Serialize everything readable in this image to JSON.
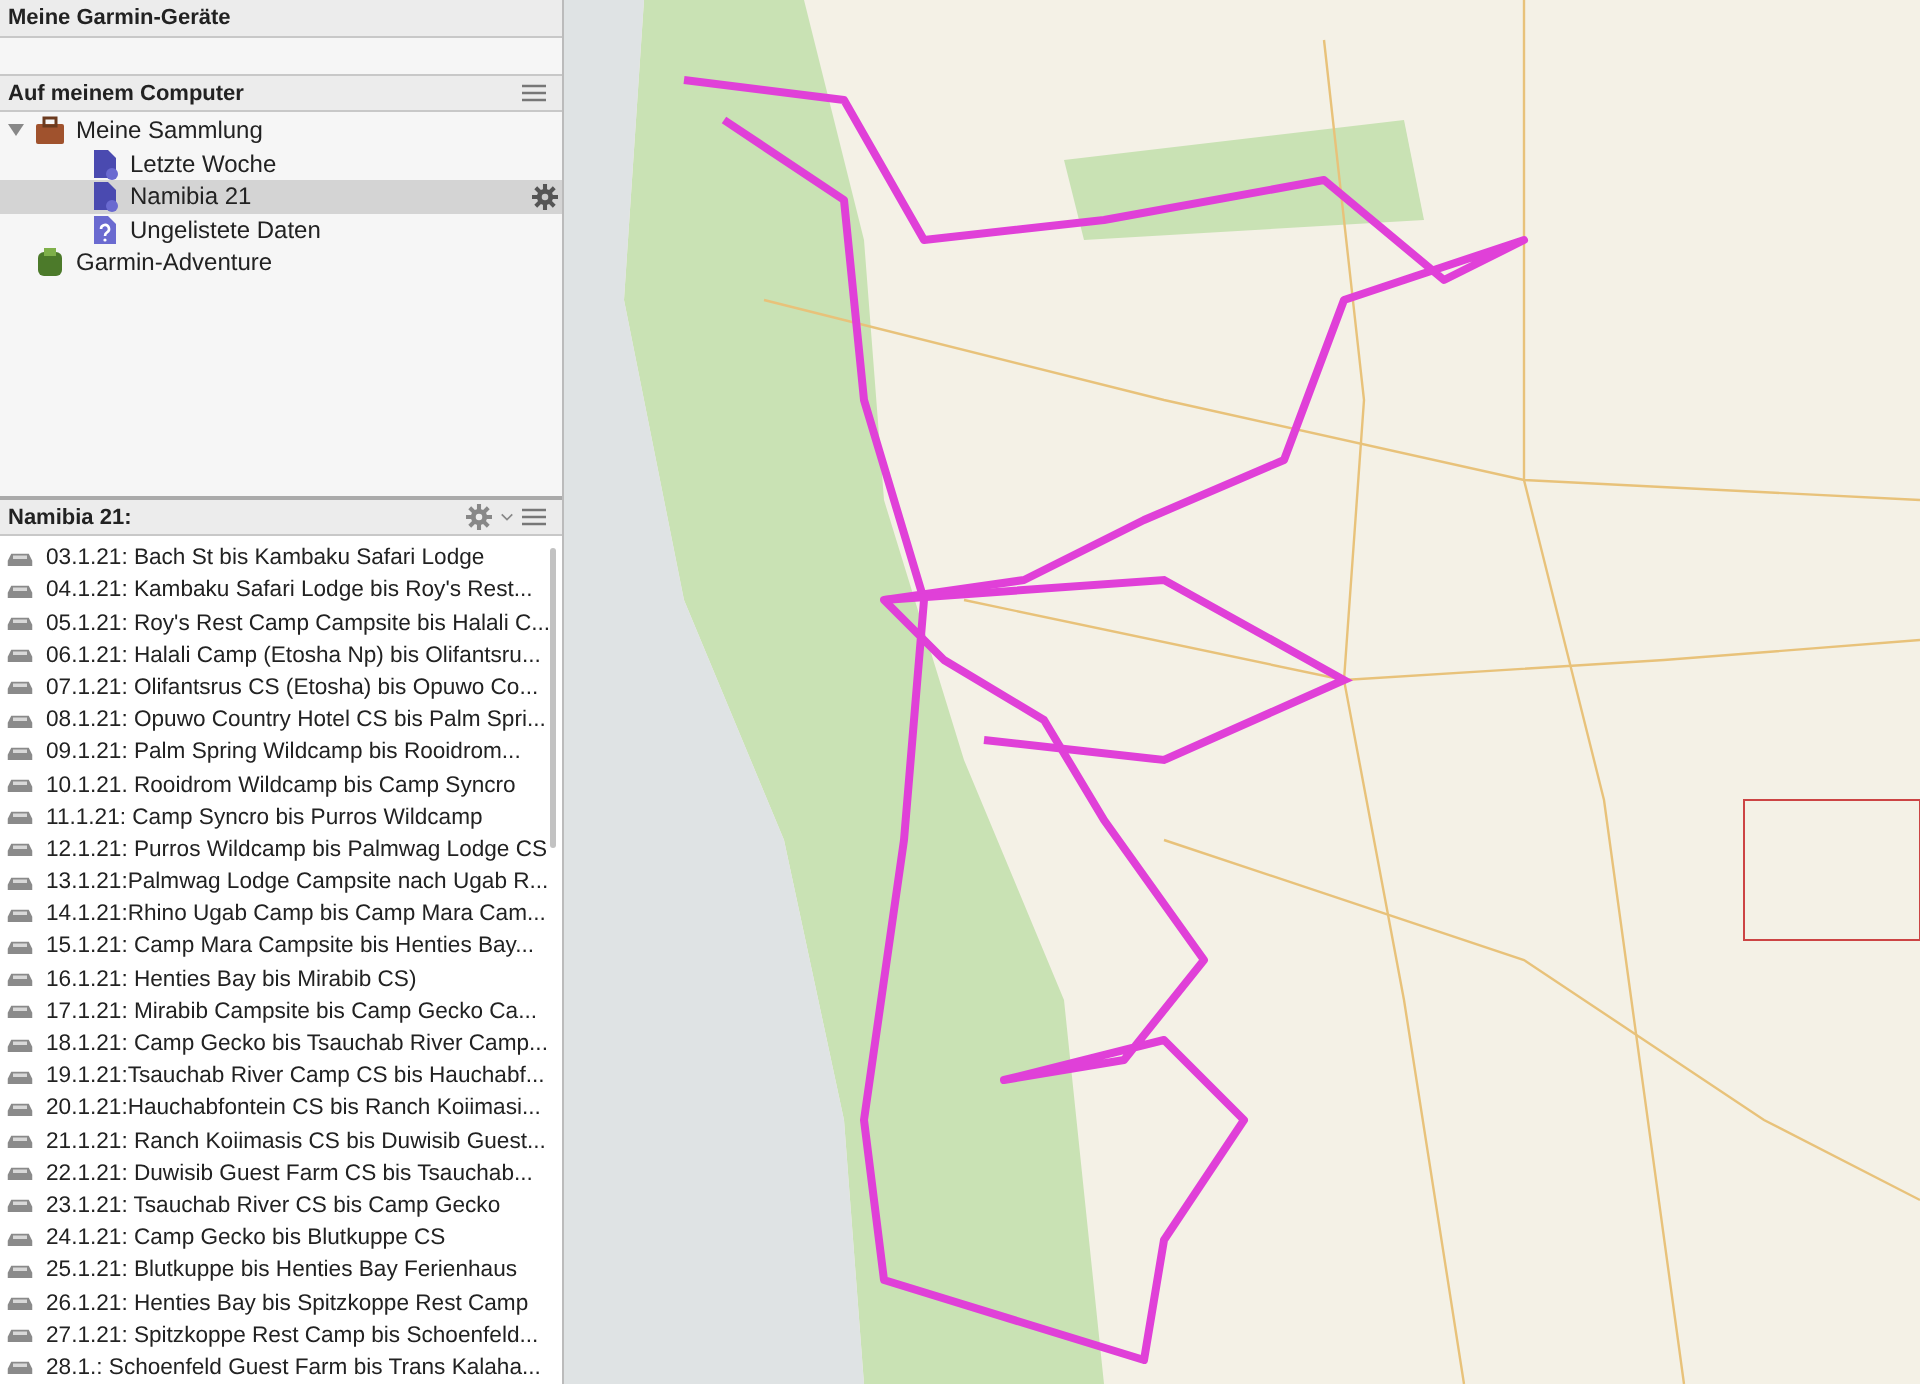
{
  "devices_header": {
    "title": "Meine Garmin-Geräte"
  },
  "computer_header": {
    "title": "Auf meinem Computer"
  },
  "tree": [
    {
      "label": "Meine Sammlung",
      "kind": "collection",
      "expanded": true,
      "selected": false,
      "children": [
        {
          "label": "Letzte Woche",
          "kind": "list",
          "selected": false
        },
        {
          "label": "Namibia 21",
          "kind": "list",
          "selected": true
        },
        {
          "label": "Ungelistete Daten",
          "kind": "unlisted",
          "selected": false
        }
      ]
    },
    {
      "label": "Garmin-Adventure",
      "kind": "adventure",
      "selected": false
    }
  ],
  "list_header": {
    "title": "Namibia 21:"
  },
  "routes": [
    {
      "label": "03.1.21: Bach St bis Kambaku Safari Lodge"
    },
    {
      "label": "04.1.21: Kambaku Safari Lodge bis Roy's Rest..."
    },
    {
      "label": "05.1.21: Roy's Rest Camp Campsite bis Halali C..."
    },
    {
      "label": "06.1.21: Halali Camp (Etosha Np) bis Olifantsru..."
    },
    {
      "label": "07.1.21: Olifantsrus CS (Etosha) bis Opuwo Co..."
    },
    {
      "label": "08.1.21: Opuwo Country Hotel CS bis Palm Spri..."
    },
    {
      "label": "09.1.21: Palm Spring Wildcamp bis Rooidrom..."
    },
    {
      "label": "10.1.21. Rooidrom Wildcamp bis Camp Syncro"
    },
    {
      "label": "11.1.21: Camp Syncro bis Purros Wildcamp"
    },
    {
      "label": "12.1.21: Purros Wildcamp bis Palmwag Lodge CS"
    },
    {
      "label": "13.1.21:Palmwag Lodge Campsite nach Ugab R..."
    },
    {
      "label": "14.1.21:Rhino Ugab Camp bis Camp Mara Cam..."
    },
    {
      "label": "15.1.21: Camp Mara Campsite bis Henties Bay..."
    },
    {
      "label": "16.1.21: Henties Bay bis Mirabib CS)"
    },
    {
      "label": "17.1.21: Mirabib Campsite bis Camp Gecko Ca..."
    },
    {
      "label": "18.1.21: Camp Gecko bis Tsauchab River Camp..."
    },
    {
      "label": "19.1.21:Tsauchab River Camp CS bis Hauchabf..."
    },
    {
      "label": "20.1.21:Hauchabfontein CS bis Ranch Koiimasi..."
    },
    {
      "label": "21.1.21: Ranch Koiimasis CS bis Duwisib Guest..."
    },
    {
      "label": "22.1.21: Duwisib Guest Farm CS bis Tsauchab..."
    },
    {
      "label": "23.1.21: Tsauchab River CS bis Camp Gecko"
    },
    {
      "label": "24.1.21: Camp Gecko bis Blutkuppe CS"
    },
    {
      "label": "25.1.21: Blutkuppe bis Henties Bay Ferienhaus"
    },
    {
      "label": "26.1.21: Henties Bay bis Spitzkoppe Rest Camp"
    },
    {
      "label": "27.1.21: Spitzkoppe Rest Camp bis Schoenfeld..."
    },
    {
      "label": "28.1.: Schoenfeld Guest Farm bis Trans Kalaha..."
    }
  ]
}
